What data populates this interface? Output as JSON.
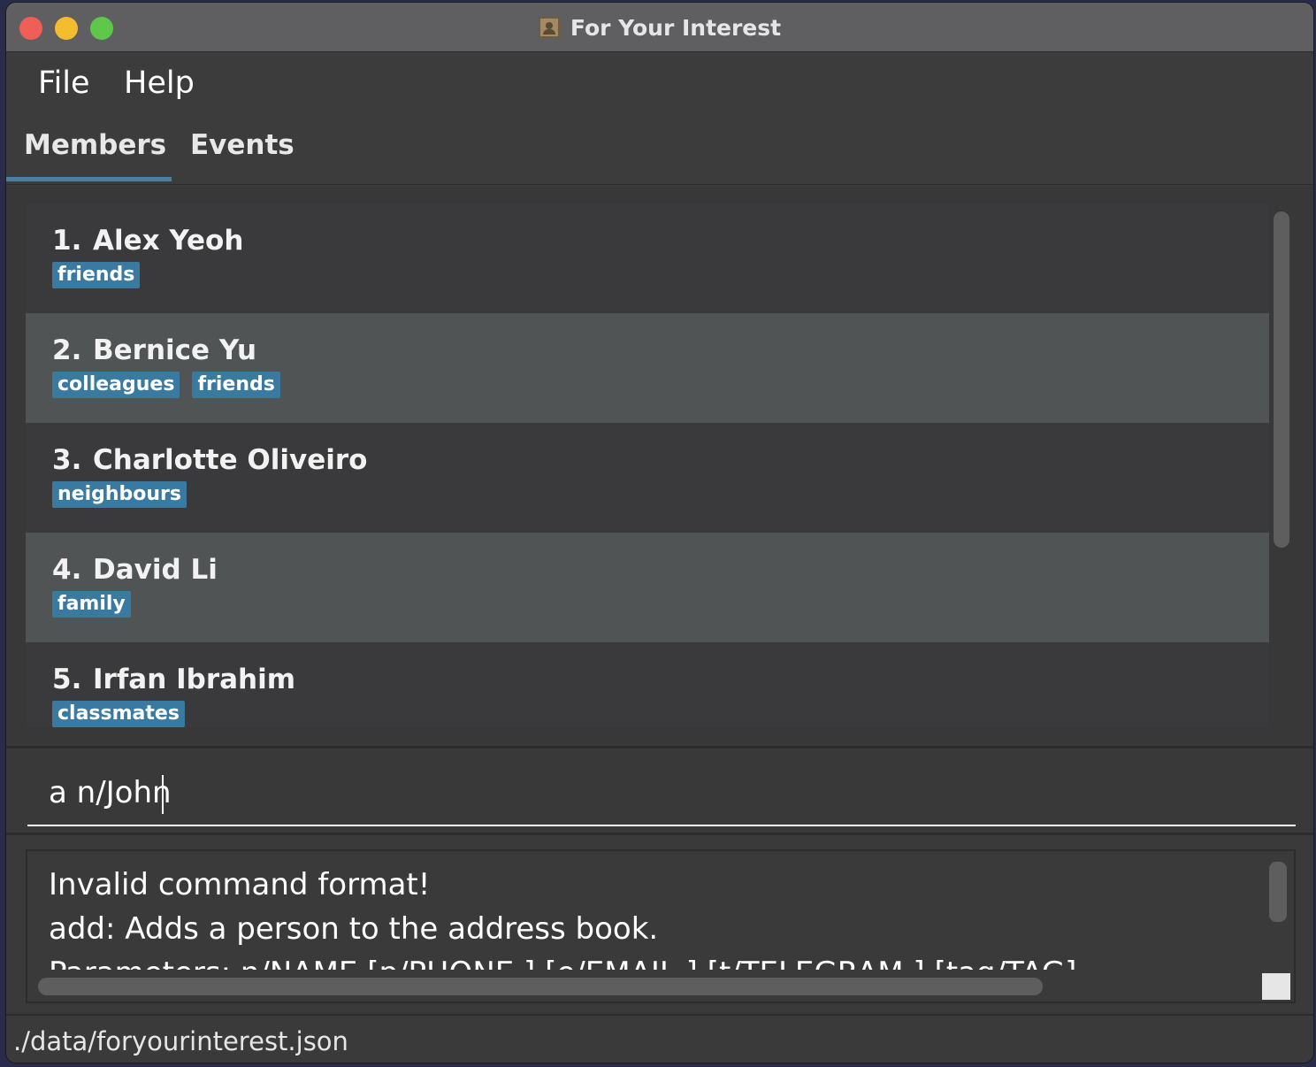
{
  "window": {
    "title": "For Your Interest",
    "icon": "address-book-icon"
  },
  "menu": {
    "items": [
      {
        "label": "File"
      },
      {
        "label": "Help"
      }
    ]
  },
  "tabs": {
    "items": [
      {
        "label": "Members",
        "active": true
      },
      {
        "label": "Events",
        "active": false
      }
    ]
  },
  "members": [
    {
      "index": "1.",
      "name": "Alex Yeoh",
      "tags": [
        "friends"
      ]
    },
    {
      "index": "2.",
      "name": "Bernice Yu",
      "tags": [
        "colleagues",
        "friends"
      ]
    },
    {
      "index": "3.",
      "name": "Charlotte Oliveiro",
      "tags": [
        "neighbours"
      ]
    },
    {
      "index": "4.",
      "name": "David Li",
      "tags": [
        "family"
      ]
    },
    {
      "index": "5.",
      "name": "Irfan Ibrahim",
      "tags": [
        "classmates"
      ]
    }
  ],
  "command": {
    "value": "a n/John"
  },
  "result": {
    "lines": [
      "Invalid command format!",
      "add: Adds a person to the address book.",
      "Parameters: n/NAME [p/PHONE ] [e/EMAIL ] [t/TELEGRAM ] [tag/TAG]"
    ]
  },
  "status": {
    "file_path": "./data/foryourinterest.json"
  },
  "colors": {
    "tag_bg": "#3b7aa0",
    "tab_underline": "#4a7fa3",
    "traffic_close": "#ee5f58",
    "traffic_min": "#f3bd2f",
    "traffic_max": "#5fc84a"
  }
}
